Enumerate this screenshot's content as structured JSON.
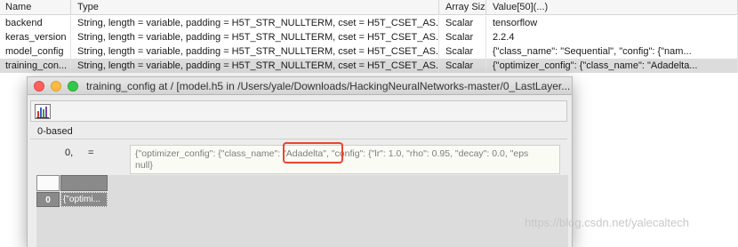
{
  "table": {
    "headers": [
      "Name",
      "Type",
      "Array Size",
      "Value[50](...)"
    ],
    "rows": [
      {
        "name": "backend",
        "type": "String, length = variable, padding = H5T_STR_NULLTERM, cset = H5T_CSET_AS...",
        "size": "Scalar",
        "value": "tensorflow"
      },
      {
        "name": "keras_version",
        "type": "String, length = variable, padding = H5T_STR_NULLTERM, cset = H5T_CSET_AS...",
        "size": "Scalar",
        "value": "2.2.4"
      },
      {
        "name": "model_config",
        "type": "String, length = variable, padding = H5T_STR_NULLTERM, cset = H5T_CSET_AS...",
        "size": "Scalar",
        "value": "{\"class_name\": \"Sequential\", \"config\": {\"nam..."
      },
      {
        "name": "training_con...",
        "type": "String, length = variable, padding = H5T_STR_NULLTERM, cset = H5T_CSET_AS...",
        "size": "Scalar",
        "value": "{\"optimizer_config\": {\"class_name\": \"Adadelta..."
      }
    ]
  },
  "window": {
    "title": "training_config  at  / [model.h5  in  /Users/yale/Downloads/HackingNeuralNetworks-master/0_LastLayer...",
    "zero_based": "0-based",
    "index": "0,",
    "equals": "=",
    "value_line1": "{\"optimizer_config\": {\"class_name\": \"Adadelta\", \"config\": {\"lr\": 1.0, \"rho\": 0.95, \"decay\": 0.0, \"eps",
    "value_line2": "null}",
    "grid_row_index": "0",
    "grid_cell": "{\"optimi..."
  },
  "icons": {
    "toolbar_chart": "bar-chart-icon"
  },
  "colors": {
    "highlight": "#e8472f",
    "close": "#fc605c",
    "minimize": "#fdbc40",
    "zoom": "#34c84a"
  },
  "watermark": "https://blog.csdn.net/yalecaltech"
}
